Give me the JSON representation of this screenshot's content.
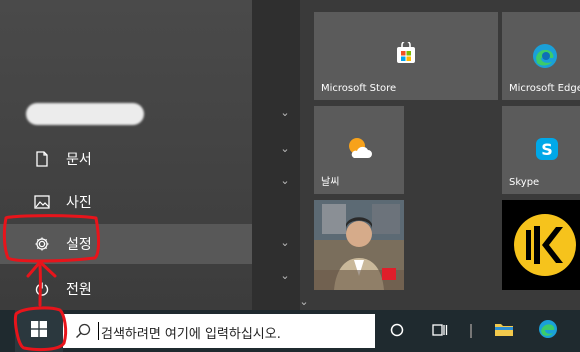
{
  "start_menu": {
    "user_name_redacted": "",
    "items": [
      {
        "id": "documents",
        "label": "문서",
        "icon": "document-icon"
      },
      {
        "id": "pictures",
        "label": "사진",
        "icon": "picture-icon"
      },
      {
        "id": "settings",
        "label": "설정",
        "icon": "gear-icon",
        "active": true
      },
      {
        "id": "power",
        "label": "전원",
        "icon": "power-icon"
      }
    ],
    "tiles": [
      {
        "id": "microsoft-store",
        "label": "Microsoft Store"
      },
      {
        "id": "microsoft-edge",
        "label": "Microsoft Edge"
      },
      {
        "id": "weather",
        "label": "날씨"
      },
      {
        "id": "skype",
        "label": "Skype"
      },
      {
        "id": "photo",
        "label": ""
      },
      {
        "id": "kakao-app",
        "label": ""
      }
    ]
  },
  "taskbar": {
    "search_placeholder": "검색하려면 여기에 입력하십시오.",
    "icons": [
      "windows-logo-icon",
      "search-icon",
      "cortana-icon",
      "task-view-icon",
      "file-explorer-icon",
      "edge-icon"
    ]
  },
  "annotation": {
    "color": "#e8141b",
    "description": "red highlight around settings and start button"
  },
  "colors": {
    "taskbar": "#1f2a2f",
    "menu_bg": "#3a3a3a",
    "active_item": "#585858",
    "tile": "#5b5b5b"
  }
}
